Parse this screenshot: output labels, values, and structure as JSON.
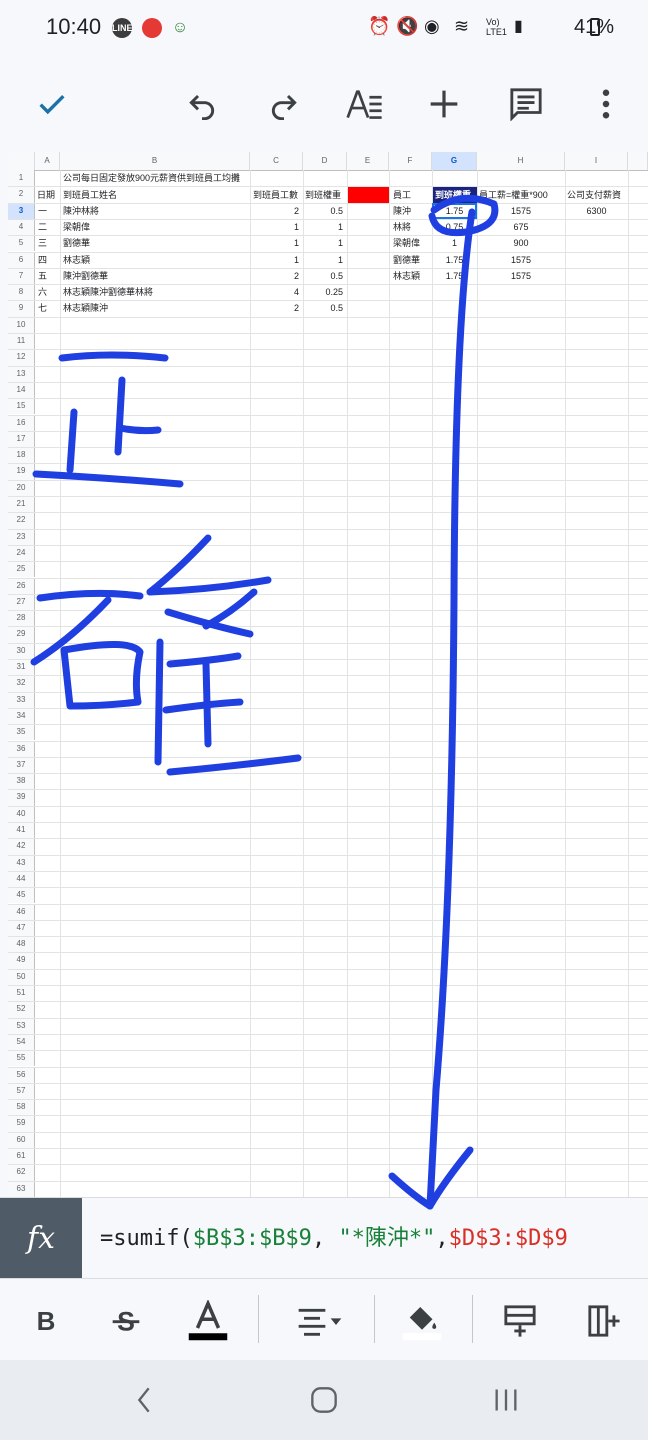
{
  "status_bar": {
    "time": "10:40",
    "battery": "41%",
    "network": "Vo) LTE1"
  },
  "toolbar": {
    "actions": [
      "confirm",
      "undo",
      "redo",
      "text-format",
      "insert",
      "comments",
      "more"
    ]
  },
  "sheet": {
    "columns": [
      "A",
      "B",
      "C",
      "D",
      "E",
      "F",
      "G",
      "H",
      "I"
    ],
    "selected_column": "G",
    "selected_row": "3",
    "row_numbers": [
      "1",
      "2",
      "3",
      "4",
      "5",
      "6",
      "7",
      "8",
      "9",
      "10",
      "11",
      "12",
      "13",
      "14",
      "15",
      "16",
      "17",
      "18",
      "19",
      "20",
      "21",
      "22",
      "23",
      "24",
      "25",
      "26",
      "27",
      "28",
      "29",
      "30",
      "31",
      "32",
      "33",
      "34",
      "35",
      "36",
      "37",
      "38",
      "39",
      "40",
      "41",
      "42",
      "43",
      "44",
      "45",
      "46",
      "47",
      "48",
      "49",
      "50",
      "51",
      "52",
      "53",
      "54",
      "55",
      "56",
      "57",
      "58",
      "59",
      "60",
      "61",
      "62",
      "63"
    ],
    "title": "公司每日固定發放900元薪資供到班員工均攤",
    "headers": {
      "A": "日期",
      "B": "到班員工姓名",
      "C": "到班員工數",
      "D": "到班權重",
      "F": "員工",
      "G": "到班權重",
      "H": "員工薪=權重*900",
      "I": "公司支付薪資"
    },
    "left_rows": [
      {
        "A": "一",
        "B": "陳沖林將",
        "C": "2",
        "D": "0.5"
      },
      {
        "A": "二",
        "B": "梁朝偉",
        "C": "1",
        "D": "1"
      },
      {
        "A": "三",
        "B": "劉德華",
        "C": "1",
        "D": "1"
      },
      {
        "A": "四",
        "B": "林志穎",
        "C": "1",
        "D": "1"
      },
      {
        "A": "五",
        "B": "陳沖劉德華",
        "C": "2",
        "D": "0.5"
      },
      {
        "A": "六",
        "B": "林志穎陳沖劉德華林將",
        "C": "4",
        "D": "0.25"
      },
      {
        "A": "七",
        "B": "林志穎陳沖",
        "C": "2",
        "D": "0.5"
      }
    ],
    "right_rows": [
      {
        "F": "陳沖",
        "G": "1.75",
        "H": "1575",
        "I": "6300"
      },
      {
        "F": "林將",
        "G": "0.75",
        "H": "675",
        "I": ""
      },
      {
        "F": "梁朝偉",
        "G": "1",
        "H": "900",
        "I": ""
      },
      {
        "F": "劉德華",
        "G": "1.75",
        "H": "1575",
        "I": ""
      },
      {
        "F": "林志穎",
        "G": "1.75",
        "H": "1575",
        "I": ""
      }
    ],
    "header_fill_E": "#ff0000",
    "header_fill_G": "#1a237e"
  },
  "handwriting": {
    "text": "正確",
    "color": "#1f3fe0"
  },
  "formula_bar": {
    "fx_label": "fx",
    "formula_parts": [
      {
        "text": "=sumif(",
        "color": "#202124"
      },
      {
        "text": "$B$3:$B$9",
        "color": "#188038"
      },
      {
        "text": ", ",
        "color": "#202124"
      },
      {
        "text": "\"*陳沖*\"",
        "color": "#188038"
      },
      {
        "text": ",",
        "color": "#202124"
      },
      {
        "text": "$D$3:$D$9",
        "color": "#d93025"
      }
    ]
  },
  "format_bar": {
    "actions": [
      "bold",
      "strikethrough",
      "text-color",
      "align",
      "fill-color",
      "insert-row",
      "insert-column"
    ]
  },
  "nav_bar": {
    "actions": [
      "back",
      "home",
      "recents"
    ]
  }
}
